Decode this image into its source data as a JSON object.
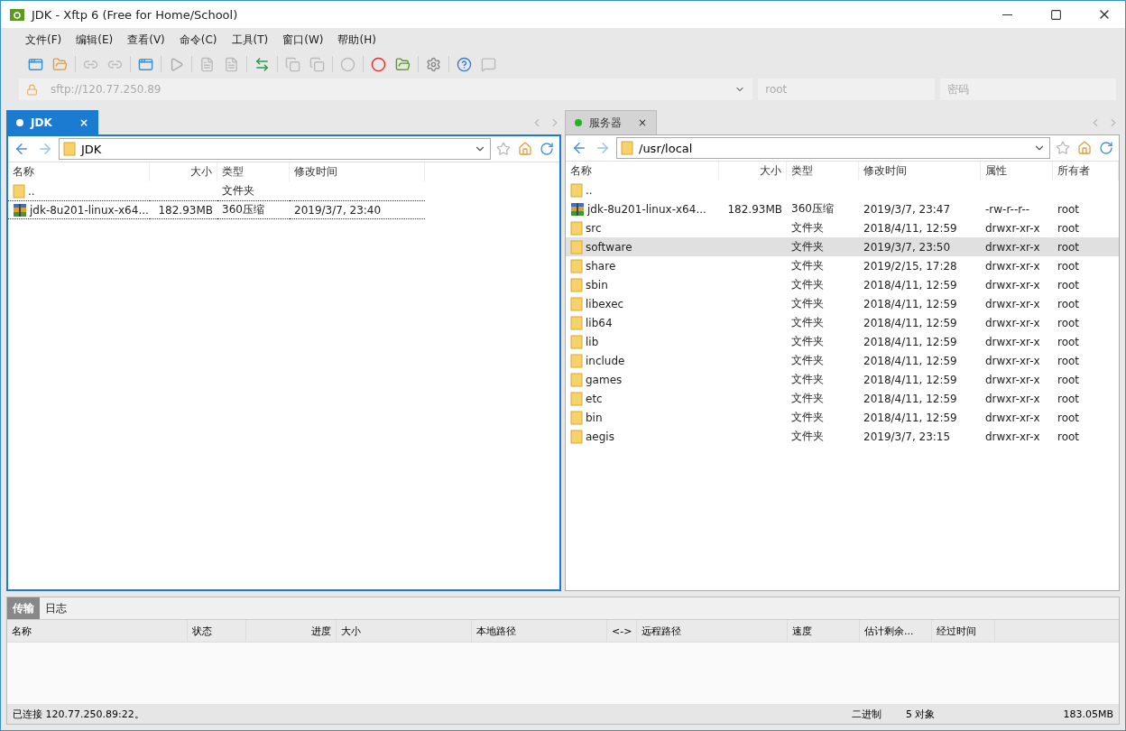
{
  "window": {
    "title": "JDK - Xftp 6 (Free for Home/School)"
  },
  "menu": [
    "文件(F)",
    "编辑(E)",
    "查看(V)",
    "命令(C)",
    "工具(T)",
    "窗口(W)",
    "帮助(H)"
  ],
  "address": {
    "placeholder": "sftp://120.77.250.89",
    "user_placeholder": "root",
    "password_placeholder": "密码"
  },
  "panes": [
    {
      "tab": {
        "label": "JDK",
        "close": "×",
        "selected": true,
        "color": "#ffffff"
      },
      "path": "JDK",
      "columns": [
        "名称",
        "大小",
        "类型",
        "修改时间"
      ],
      "rows": [
        {
          "kind": "parent",
          "cells": [
            "..",
            "",
            "文件夹",
            ""
          ],
          "selected": false,
          "focused": false
        },
        {
          "kind": "archive",
          "cells": [
            "jdk-8u201-linux-x64...",
            "182.93MB",
            "360压缩",
            "2019/3/7, 23:40"
          ],
          "selected": false,
          "focused": true
        }
      ]
    },
    {
      "tab": {
        "label": "服务器",
        "close": "×",
        "selected": false,
        "color": "#22b422"
      },
      "path": "/usr/local",
      "columns": [
        "名称",
        "大小",
        "类型",
        "修改时间",
        "属性",
        "所有者"
      ],
      "rows": [
        {
          "kind": "parent",
          "cells": [
            "..",
            "",
            "",
            "",
            "",
            ""
          ],
          "selected": false,
          "focused": false
        },
        {
          "kind": "archive",
          "cells": [
            "jdk-8u201-linux-x64...",
            "182.93MB",
            "360压缩",
            "2019/3/7, 23:47",
            "-rw-r--r--",
            "root"
          ],
          "selected": false,
          "focused": false
        },
        {
          "kind": "folder",
          "cells": [
            "src",
            "",
            "文件夹",
            "2018/4/11, 12:59",
            "drwxr-xr-x",
            "root"
          ],
          "selected": false,
          "focused": false
        },
        {
          "kind": "folder",
          "cells": [
            "software",
            "",
            "文件夹",
            "2019/3/7, 23:50",
            "drwxr-xr-x",
            "root"
          ],
          "selected": true,
          "focused": false
        },
        {
          "kind": "folder",
          "cells": [
            "share",
            "",
            "文件夹",
            "2019/2/15, 17:28",
            "drwxr-xr-x",
            "root"
          ],
          "selected": false,
          "focused": false
        },
        {
          "kind": "folder",
          "cells": [
            "sbin",
            "",
            "文件夹",
            "2018/4/11, 12:59",
            "drwxr-xr-x",
            "root"
          ],
          "selected": false,
          "focused": false
        },
        {
          "kind": "folder",
          "cells": [
            "libexec",
            "",
            "文件夹",
            "2018/4/11, 12:59",
            "drwxr-xr-x",
            "root"
          ],
          "selected": false,
          "focused": false
        },
        {
          "kind": "folder",
          "cells": [
            "lib64",
            "",
            "文件夹",
            "2018/4/11, 12:59",
            "drwxr-xr-x",
            "root"
          ],
          "selected": false,
          "focused": false
        },
        {
          "kind": "folder",
          "cells": [
            "lib",
            "",
            "文件夹",
            "2018/4/11, 12:59",
            "drwxr-xr-x",
            "root"
          ],
          "selected": false,
          "focused": false
        },
        {
          "kind": "folder",
          "cells": [
            "include",
            "",
            "文件夹",
            "2018/4/11, 12:59",
            "drwxr-xr-x",
            "root"
          ],
          "selected": false,
          "focused": false
        },
        {
          "kind": "folder",
          "cells": [
            "games",
            "",
            "文件夹",
            "2018/4/11, 12:59",
            "drwxr-xr-x",
            "root"
          ],
          "selected": false,
          "focused": false
        },
        {
          "kind": "folder",
          "cells": [
            "etc",
            "",
            "文件夹",
            "2018/4/11, 12:59",
            "drwxr-xr-x",
            "root"
          ],
          "selected": false,
          "focused": false
        },
        {
          "kind": "folder",
          "cells": [
            "bin",
            "",
            "文件夹",
            "2018/4/11, 12:59",
            "drwxr-xr-x",
            "root"
          ],
          "selected": false,
          "focused": false
        },
        {
          "kind": "folder",
          "cells": [
            "aegis",
            "",
            "文件夹",
            "2019/3/7, 23:15",
            "drwxr-xr-x",
            "root"
          ],
          "selected": false,
          "focused": false
        }
      ]
    }
  ],
  "bottom_tabs": [
    {
      "label": "传输",
      "selected": true
    },
    {
      "label": "日志",
      "selected": false
    }
  ],
  "transfer_columns": [
    "名称",
    "状态",
    "进度",
    "大小",
    "本地路径",
    "<->",
    "远程路径",
    "速度",
    "估计剩余...",
    "经过时间"
  ],
  "status_bar": {
    "connection": "已连接 120.77.250.89:22。",
    "mode": "二进制",
    "objects": "5 对象",
    "size": "183.05MB"
  }
}
